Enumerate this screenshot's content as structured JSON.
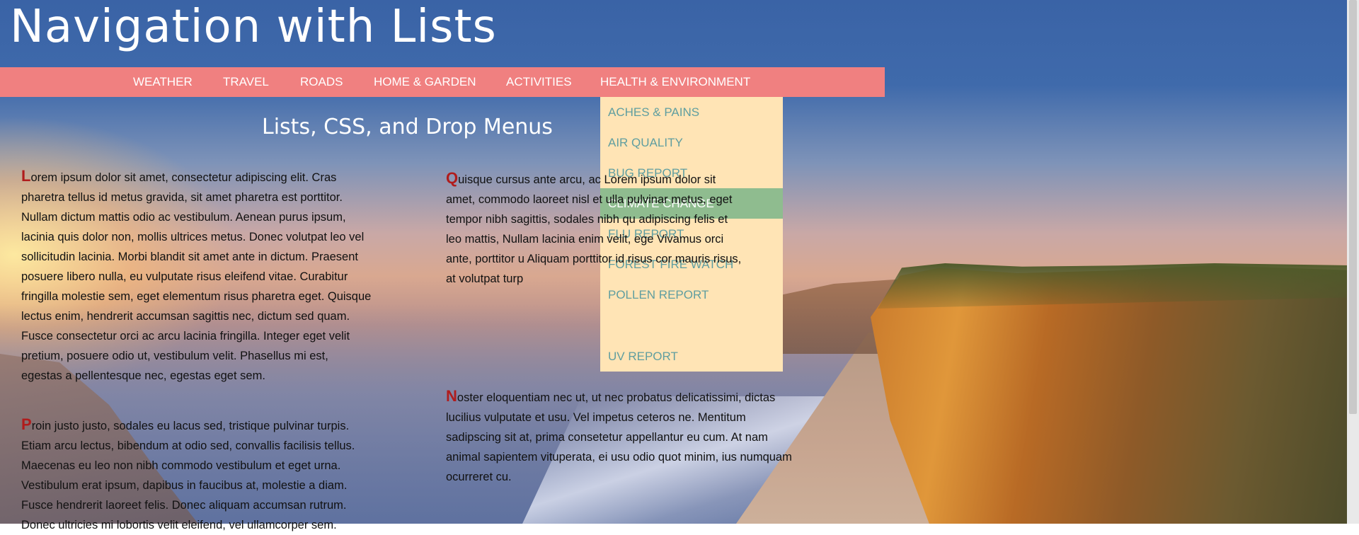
{
  "page": {
    "title": "Navigation with Lists",
    "subtitle": "Lists, CSS, and Drop Menus"
  },
  "nav": {
    "items": [
      {
        "label": "WEATHER"
      },
      {
        "label": "TRAVEL"
      },
      {
        "label": "ROADS"
      },
      {
        "label": "HOME & GARDEN"
      },
      {
        "label": "ACTIVITIES"
      },
      {
        "label": "HEALTH & ENVIRONMENT"
      }
    ]
  },
  "dropdown": {
    "items": [
      {
        "label": "ACHES & PAINS"
      },
      {
        "label": "AIR QUALITY"
      },
      {
        "label": "BUG REPORT"
      },
      {
        "label": "CLIMATE CHANGE",
        "active": true
      },
      {
        "label": "FLU REPORT"
      },
      {
        "label": "FOREST FIRE WATCH"
      },
      {
        "label": "POLLEN REPORT"
      },
      {
        "label": ""
      },
      {
        "label": "UV REPORT"
      }
    ]
  },
  "content": {
    "paragraphs": [
      {
        "first": "L",
        "rest": "orem ipsum dolor sit amet, consectetur adipiscing elit. Cras pharetra tellus id metus gravida, sit amet pharetra est porttitor. Nullam dictum mattis odio ac vestibulum. Aenean purus ipsum, lacinia quis dolor non, mollis ultrices metus. Donec volutpat leo vel sollicitudin lacinia. Morbi blandit sit amet ante in dictum. Praesent posuere libero nulla, eu vulputate risus eleifend vitae. Curabitur fringilla molestie sem, eget elementum risus pharetra eget. Quisque lectus enim, hendrerit accumsan sagittis nec, dictum sed quam. Fusce consectetur orci ac arcu lacinia fringilla. Integer eget velit pretium, posuere odio ut, vestibulum velit. Phasellus mi est, egestas a pellentesque nec, egestas eget sem."
      },
      {
        "first": "P",
        "rest": "roin justo justo, sodales eu lacus sed, tristique pulvinar turpis. Etiam arcu lectus, bibendum at odio sed, convallis facilisis tellus. Maecenas eu leo non nibh commodo vestibulum et eget urna. Vestibulum erat ipsum, dapibus in faucibus at, molestie a diam. Fusce hendrerit laoreet felis. Donec aliquam accumsan rutrum. Donec ultricies mi lobortis velit eleifend, vel ullamcorper sem."
      },
      {
        "first": "Q",
        "rest": "uisque cursus ante arcu, ac Lorem ipsum dolor sit amet, commodo laoreet nisl et ulla pulvinar metus, eget tempor nibh sagittis, sodales nibh qu adipiscing felis et leo mattis, Nullam lacinia enim velit, ege Vivamus orci ante, porttitor u Aliquam porttitor id risus cor mauris risus, at volutpat turp"
      },
      {
        "first": "N",
        "rest": "oster eloquentiam nec ut, ut nec probatus delicatissimi, dictas lucilius vulputate et usu. Vel impetus ceteros ne. Mentitum sadipscing sit at, prima consetetur appellantur eu cum. At nam animal sapientem vituperata, ei usu odio quot minim, ius numquam ocurreret cu."
      }
    ]
  },
  "colors": {
    "nav_background": "#f08080",
    "dropdown_background": "#ffe4b5",
    "dropdown_text": "#5f9ea0",
    "active_item_background": "#8fbc8f",
    "drop_cap": "#b01c1c"
  }
}
